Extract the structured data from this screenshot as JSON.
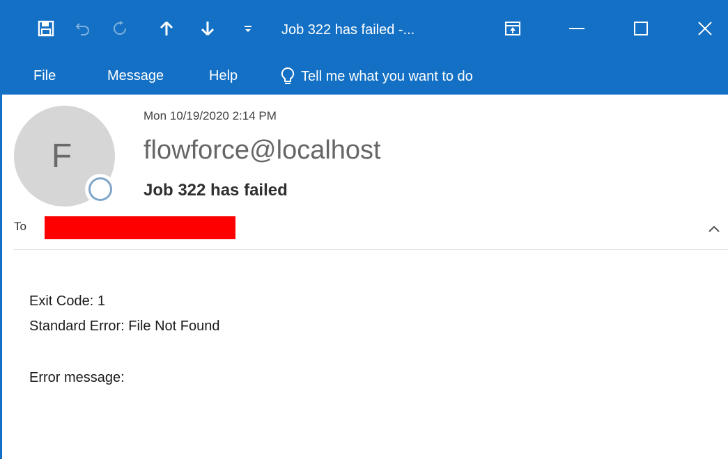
{
  "window": {
    "title": "Job 322 has failed  -...",
    "accent_color": "#1470c4"
  },
  "quick_access": [
    {
      "icon": "save-icon"
    },
    {
      "icon": "undo-icon",
      "disabled": true
    },
    {
      "icon": "redo-icon",
      "disabled": true
    },
    {
      "icon": "previous-item-icon"
    },
    {
      "icon": "next-item-icon"
    },
    {
      "icon": "customize-toolbar-icon"
    }
  ],
  "menu": {
    "file": "File",
    "message": "Message",
    "help": "Help",
    "tell_me": "Tell me what you want to do"
  },
  "message": {
    "avatar_initial": "F",
    "date": "Mon 10/19/2020 2:14 PM",
    "sender": "flowforce@localhost",
    "subject": "Job 322 has failed",
    "to_label": "To",
    "to_redaction_color": "#ff0000",
    "body": {
      "exit_code": "Exit Code: 1",
      "standard_error": "Standard Error: File Not Found",
      "error_message": "Error message:"
    }
  }
}
